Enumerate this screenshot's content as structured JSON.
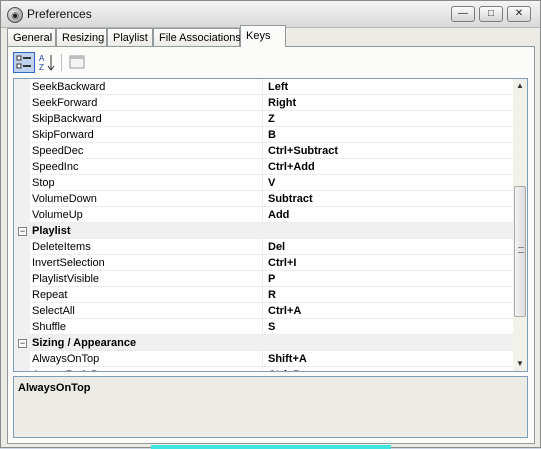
{
  "window": {
    "title": "Preferences",
    "minimize": "—",
    "maximize": "□",
    "close": "✕"
  },
  "tabs": [
    {
      "label": "General"
    },
    {
      "label": "Resizing"
    },
    {
      "label": "Playlist"
    },
    {
      "label": "File Associations"
    },
    {
      "label": "Keys"
    }
  ],
  "active_tab": "Keys",
  "toolbar": {
    "categorized_icon": "categorized-icon",
    "alphabetical_icon": "sort-az-icon",
    "pages_icon": "property-pages-icon"
  },
  "grid": {
    "rows": [
      {
        "name": "SeekBackward",
        "value": "Left"
      },
      {
        "name": "SeekForward",
        "value": "Right"
      },
      {
        "name": "SkipBackward",
        "value": "Z"
      },
      {
        "name": "SkipForward",
        "value": "B"
      },
      {
        "name": "SpeedDec",
        "value": "Ctrl+Subtract"
      },
      {
        "name": "SpeedInc",
        "value": "Ctrl+Add"
      },
      {
        "name": "Stop",
        "value": "V"
      },
      {
        "name": "VolumeDown",
        "value": "Subtract"
      },
      {
        "name": "VolumeUp",
        "value": "Add"
      },
      {
        "category": "Playlist",
        "toggle": "−"
      },
      {
        "name": "DeleteItems",
        "value": "Del"
      },
      {
        "name": "InvertSelection",
        "value": "Ctrl+I"
      },
      {
        "name": "PlaylistVisible",
        "value": "P"
      },
      {
        "name": "Repeat",
        "value": "R"
      },
      {
        "name": "SelectAll",
        "value": "Ctrl+A"
      },
      {
        "name": "Shuffle",
        "value": "S"
      },
      {
        "category": "Sizing / Appearance",
        "toggle": "−"
      },
      {
        "name": "AlwaysOnTop",
        "value": "Shift+A"
      },
      {
        "name": "AspectRatioDown",
        "value": "Ctrl+D"
      }
    ]
  },
  "scroll": {
    "up": "▲",
    "down": "▼"
  },
  "help": {
    "title": "AlwaysOnTop",
    "description": ""
  },
  "colors": {
    "accent": "#3fe6e0",
    "selection": "#c1d2ee"
  }
}
